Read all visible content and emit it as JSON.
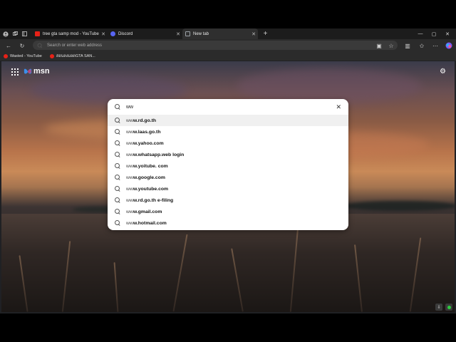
{
  "tabs": [
    {
      "label": "tree gta samp mod - YouTube",
      "favicon_color": "#e62117"
    },
    {
      "label": "Discord",
      "favicon_color": "#5865f2"
    },
    {
      "label": "New tab",
      "favicon_color": "#9aa0a6",
      "active": true
    }
  ],
  "address_bar": {
    "placeholder": "Search or enter web address"
  },
  "bookmarks": [
    {
      "label": "Wasted - YouTube"
    },
    {
      "label": "สอนลงมอดGTA SAN..."
    }
  ],
  "msn": {
    "logo_text": "msn"
  },
  "search": {
    "query": "ww",
    "suggestions": [
      {
        "prefix": "ww",
        "rest": "w.rd.go.th"
      },
      {
        "prefix": "ww",
        "rest": "w.laas.go.th"
      },
      {
        "prefix": "ww",
        "rest": "w.yahoo.com"
      },
      {
        "prefix": "ww",
        "rest": "w.whatsapp.web login"
      },
      {
        "prefix": "ww",
        "rest": "w.yoitube. com"
      },
      {
        "prefix": "ww",
        "rest": "w.google.com"
      },
      {
        "prefix": "ww",
        "rest": "w.youtube.com"
      },
      {
        "prefix": "ww",
        "rest": "w.rd.go.th e-filing"
      },
      {
        "prefix": "ww",
        "rest": "w.gmail.com"
      },
      {
        "prefix": "ww",
        "rest": "w.hotmail.com"
      }
    ]
  },
  "icons": {
    "profile": "profile-icon",
    "tab_actions": "tab-actions-icon",
    "vertical_tabs": "vertical-tabs-icon",
    "back": "back-icon",
    "refresh": "refresh-icon",
    "search": "search-icon",
    "apps": "apps-grid-icon",
    "settings": "gear-icon",
    "clear": "close-icon"
  }
}
